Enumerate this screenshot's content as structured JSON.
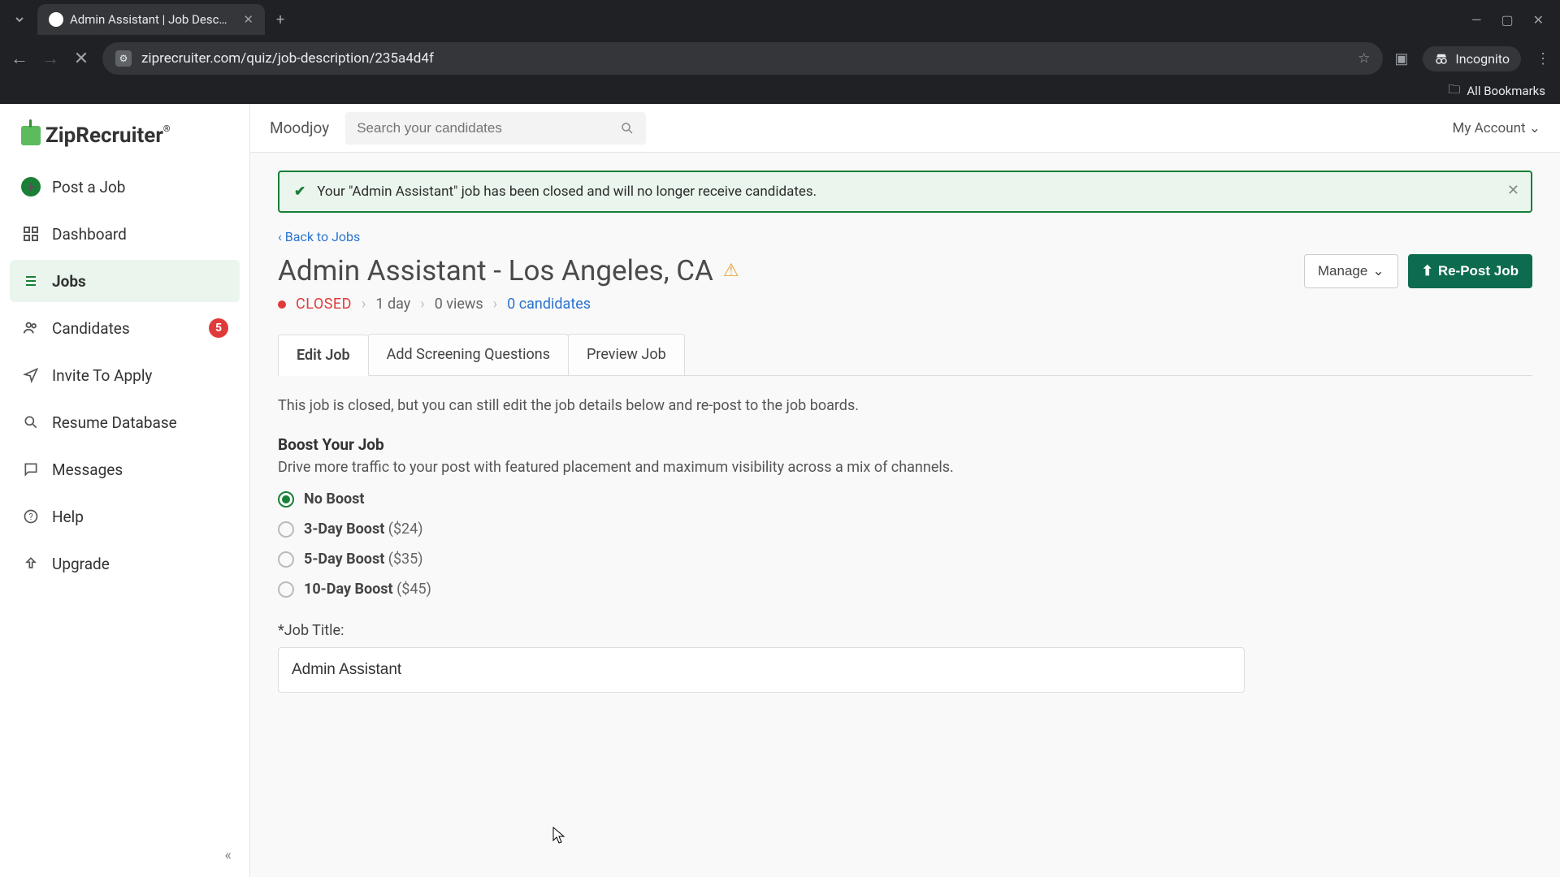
{
  "browser": {
    "tab_title": "Admin Assistant | Job Descripti",
    "url": "ziprecruiter.com/quiz/job-description/235a4d4f",
    "incognito_label": "Incognito",
    "all_bookmarks": "All Bookmarks"
  },
  "logo_text": "ZipRecruiter",
  "sidebar": {
    "post_job": "Post a Job",
    "dashboard": "Dashboard",
    "jobs": "Jobs",
    "candidates": "Candidates",
    "candidates_badge": "5",
    "invite": "Invite To Apply",
    "resume_db": "Resume Database",
    "messages": "Messages",
    "help": "Help",
    "upgrade": "Upgrade"
  },
  "topbar": {
    "org": "Moodjoy",
    "search_placeholder": "Search your candidates",
    "account": "My Account"
  },
  "alert_text": "Your \"Admin Assistant\" job has been closed and will no longer receive candidates.",
  "back_link": "Back to Jobs",
  "job": {
    "title": "Admin Assistant - Los Angeles, CA",
    "status": "CLOSED",
    "age": "1 day",
    "views": "0 views",
    "candidates": "0 candidates",
    "manage_btn": "Manage",
    "repost_btn": "Re-Post Job"
  },
  "tabs": {
    "edit": "Edit Job",
    "screening": "Add Screening Questions",
    "preview": "Preview Job"
  },
  "closed_note": "This job is closed, but you can still edit the job details below and re-post to the job boards.",
  "boost": {
    "title": "Boost Your Job",
    "desc": "Drive more traffic to your post with featured placement and maximum visibility across a mix of channels.",
    "options": [
      {
        "label": "No Boost",
        "price": ""
      },
      {
        "label": "3-Day Boost",
        "price": "($24)"
      },
      {
        "label": "5-Day Boost",
        "price": "($35)"
      },
      {
        "label": "10-Day Boost",
        "price": "($45)"
      }
    ]
  },
  "job_title_field": {
    "label": "*Job Title:",
    "value": "Admin Assistant"
  }
}
